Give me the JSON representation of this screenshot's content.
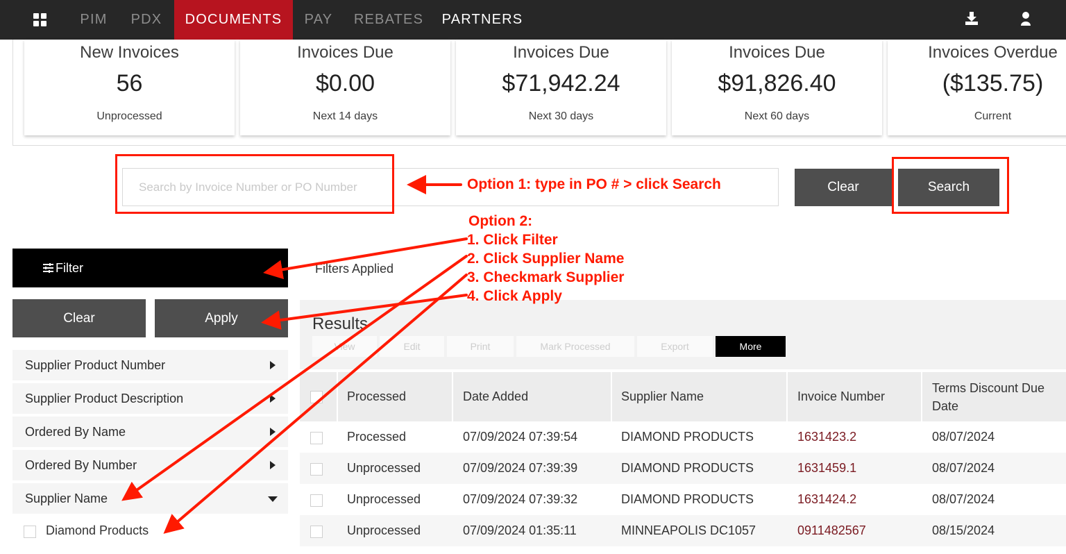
{
  "nav": {
    "items": [
      {
        "label": "PIM"
      },
      {
        "label": "PDX"
      },
      {
        "label": "DOCUMENTS"
      },
      {
        "label": "PAY"
      },
      {
        "label": "REBATES"
      },
      {
        "label": "PARTNERS"
      }
    ],
    "active": "DOCUMENTS",
    "icons": [
      "grid-icon",
      "download-icon",
      "user-icon"
    ]
  },
  "stats": [
    {
      "title": "New Invoices",
      "value": "56",
      "sub": "Unprocessed"
    },
    {
      "title": "Invoices Due",
      "value": "$0.00",
      "sub": "Next 14 days"
    },
    {
      "title": "Invoices Due",
      "value": "$71,942.24",
      "sub": "Next 30 days"
    },
    {
      "title": "Invoices Due",
      "value": "$91,826.40",
      "sub": "Next 60 days"
    },
    {
      "title": "Invoices Overdue",
      "value": "($135.75)",
      "sub": "Current"
    }
  ],
  "search": {
    "placeholder": "Search by Invoice Number or PO Number",
    "clear_label": "Clear",
    "search_label": "Search"
  },
  "filter": {
    "title": "Filter",
    "clear_label": "Clear",
    "apply_label": "Apply",
    "rows": [
      {
        "label": "Supplier Product Number"
      },
      {
        "label": "Supplier Product Description"
      },
      {
        "label": "Ordered By Name"
      },
      {
        "label": "Ordered By Number"
      },
      {
        "label": "Supplier Name"
      }
    ],
    "options": [
      {
        "label": "Diamond Products"
      }
    ]
  },
  "results": {
    "filters_applied": "Filters Applied",
    "title": "Results",
    "toolbar": [
      {
        "label": "View"
      },
      {
        "label": "Edit"
      },
      {
        "label": "Print"
      },
      {
        "label": "Mark Processed"
      },
      {
        "label": "Export"
      },
      {
        "label": "More"
      }
    ],
    "columns": [
      "Processed",
      "Date Added",
      "Supplier Name",
      "Invoice Number",
      "Terms Discount Due Date"
    ],
    "rows": [
      {
        "processed": "Processed",
        "date": "07/09/2024 07:39:54",
        "supplier": "DIAMOND PRODUCTS",
        "invoice": "1631423.2",
        "due": "08/07/2024"
      },
      {
        "processed": "Unprocessed",
        "date": "07/09/2024 07:39:39",
        "supplier": "DIAMOND PRODUCTS",
        "invoice": "1631459.1",
        "due": "08/07/2024"
      },
      {
        "processed": "Unprocessed",
        "date": "07/09/2024 07:39:32",
        "supplier": "DIAMOND PRODUCTS",
        "invoice": "1631424.2",
        "due": "08/07/2024"
      },
      {
        "processed": "Unprocessed",
        "date": "07/09/2024 01:35:11",
        "supplier": "MINNEAPOLIS DC1057",
        "invoice": "0911482567",
        "due": "08/15/2024"
      }
    ]
  },
  "annotations": {
    "option1": "Option 1:  type in PO # > click Search",
    "option2_title": "Option 2:",
    "steps": [
      "1. Click Filter",
      "2. Click Supplier Name",
      "3. Checkmark Supplier",
      "4. Click Apply"
    ],
    "color": "#ff1a00"
  },
  "colors": {
    "nav_bg": "#272727",
    "nav_active": "#b7141f",
    "button_dark": "#4e4e4e",
    "invoice_link": "#7a1a21"
  }
}
